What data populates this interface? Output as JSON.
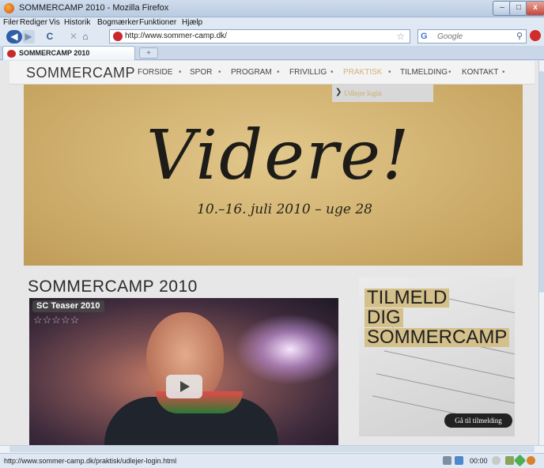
{
  "window": {
    "title": "SOMMERCAMP 2010 - Mozilla Firefox",
    "minimize": "–",
    "maximize": "□",
    "close": "x"
  },
  "menu": [
    "Filer",
    "Rediger",
    "Vis",
    "Historik",
    "Bogmærker",
    "Funktioner",
    "Hjælp"
  ],
  "nav": {
    "back": "◀",
    "forward": "▶",
    "reload": "C",
    "stop": "✕",
    "home": "⌂",
    "url": "http://www.sommer-camp.dk/",
    "search_engine": "G",
    "search_placeholder": "Google"
  },
  "tabs": [
    {
      "label": "SOMMERCAMP 2010"
    }
  ],
  "new_tab": "+",
  "site": {
    "logo": "SOMMERCAMP",
    "menu": [
      "FORSIDE",
      "SPOR",
      "PROGRAM",
      "FRIVILLIG",
      "PRAKTISK",
      "TILMELDING",
      "KONTAKT"
    ],
    "active_item": "PRAKTISK",
    "dropdown_item": "Udlejer login",
    "hero_script": "Videre!",
    "hero_date": "10.–16. juli 2010 – uge 28",
    "heading": "SOMMERCAMP 2010",
    "video": {
      "title": "SC Teaser 2010",
      "rating": 0,
      "stars": "☆☆☆☆☆"
    },
    "promo": {
      "lines": [
        "TILMELD",
        "DIG",
        "SOMMERCAMP"
      ],
      "cta": "Gå til tilmelding"
    }
  },
  "status": {
    "text": "http://www.sommer-camp.dk/praktisk/udlejer-login.html",
    "time": "00:00"
  },
  "colors": {
    "accent_gold": "#d1b27b",
    "hero_gold": "#d0b06e",
    "chrome": "#dfe8f3"
  }
}
